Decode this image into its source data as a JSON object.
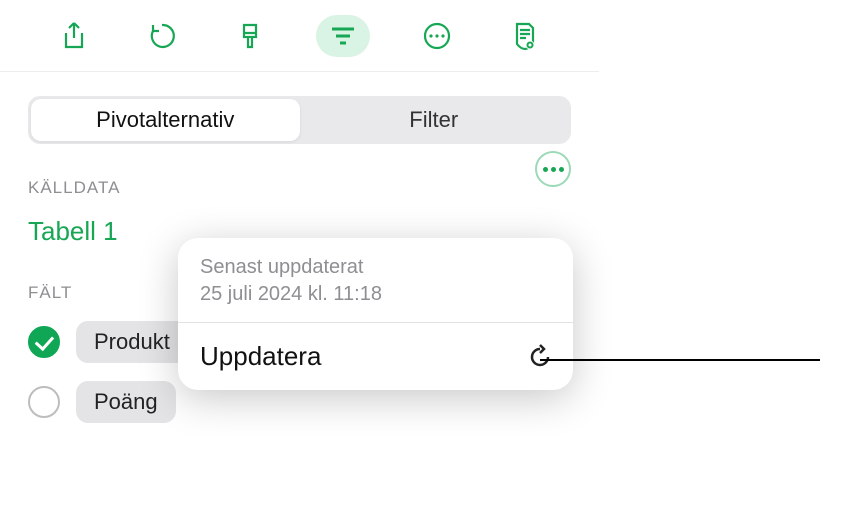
{
  "toolbar": {
    "icons": [
      "share-icon",
      "undo-icon",
      "format-brush-icon",
      "filter-lines-icon",
      "more-icon",
      "document-view-icon"
    ]
  },
  "panel": {
    "tabs": {
      "pivot_options": "Pivotalternativ",
      "filter": "Filter"
    },
    "source_data_label": "KÄLLDATA",
    "source_table": "Tabell 1",
    "fields_label": "FÄLT",
    "fields": [
      {
        "label": "Produkt",
        "checked": true
      },
      {
        "label": "Poäng",
        "checked": false
      }
    ]
  },
  "popover": {
    "last_updated_label": "Senast uppdaterat",
    "last_updated_value": "25 juli 2024 kl. 11:18",
    "action_label": "Uppdatera"
  }
}
